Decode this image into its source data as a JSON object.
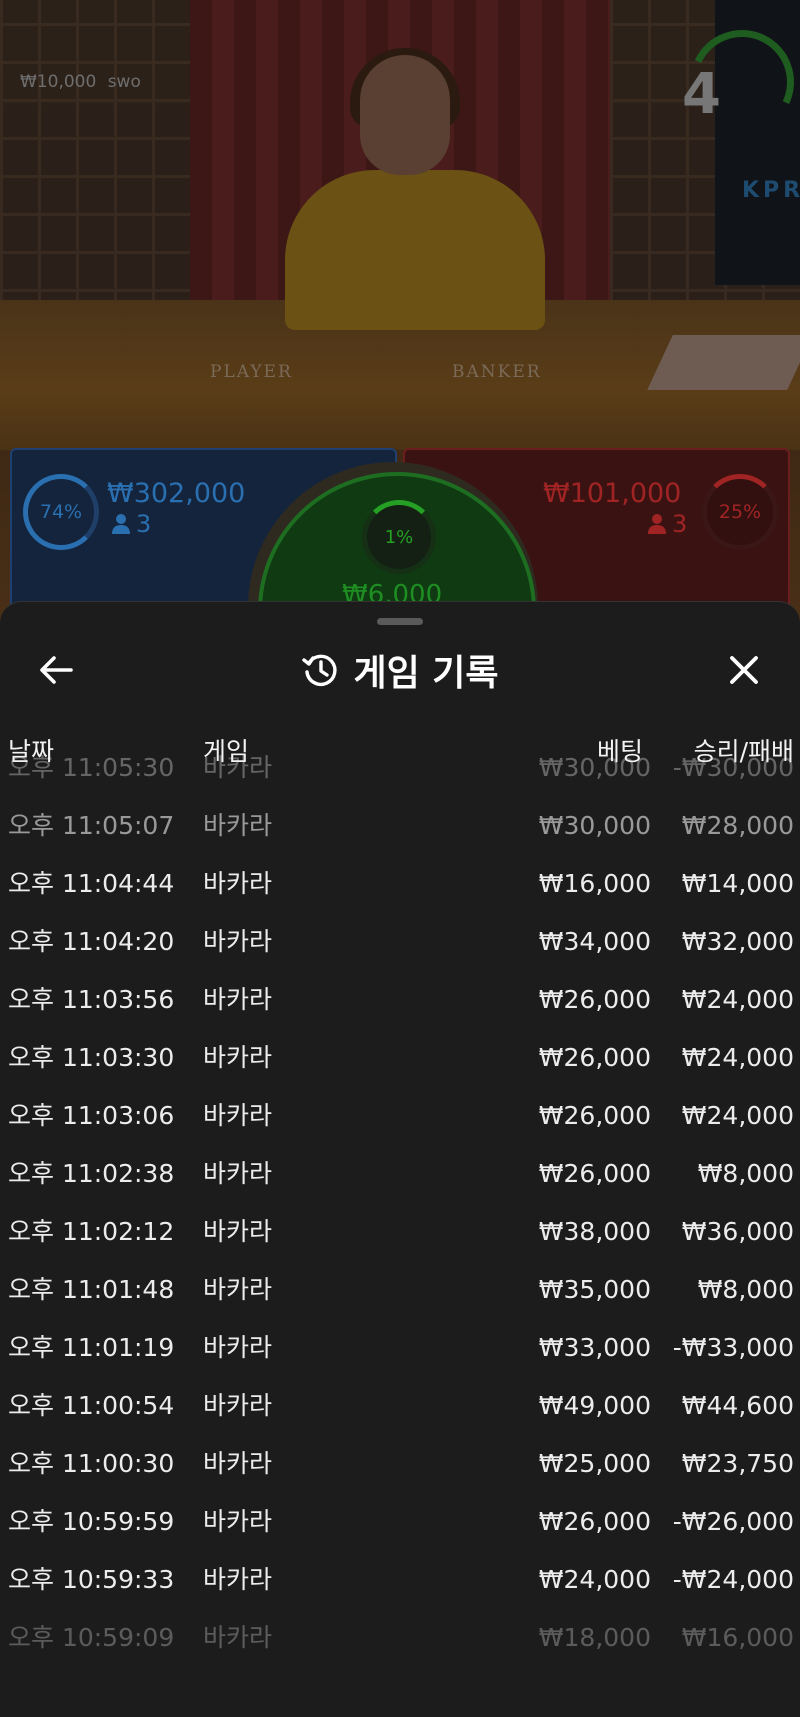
{
  "game": {
    "balance": "₩10,000",
    "username": "swo",
    "countdown": "4",
    "brand": "KPR",
    "table_labels": {
      "player": "PLAYER",
      "banker": "BANKER"
    },
    "player": {
      "percent": "74%",
      "amount": "₩302,000",
      "count": "3"
    },
    "banker": {
      "percent": "25%",
      "amount": "₩101,000",
      "count": "3"
    },
    "tie": {
      "percent": "1%",
      "amount": "₩6,000"
    },
    "colors": {
      "player": "#2a6fb0",
      "banker": "#a02424",
      "tie": "#1e8e22"
    }
  },
  "history": {
    "title": "게임 기록",
    "icons": {
      "back": "arrow-left-icon",
      "title": "history-icon",
      "close": "close-icon"
    },
    "columns": {
      "date": "날짜",
      "game": "게임",
      "bet": "베팅",
      "result": "승리/패배"
    },
    "rows": [
      {
        "time": "오후 11:05:30",
        "game": "바카라",
        "bet": "₩30,000",
        "result": "-₩30,000"
      },
      {
        "time": "오후 11:05:07",
        "game": "바카라",
        "bet": "₩30,000",
        "result": "₩28,000"
      },
      {
        "time": "오후 11:04:44",
        "game": "바카라",
        "bet": "₩16,000",
        "result": "₩14,000"
      },
      {
        "time": "오후 11:04:20",
        "game": "바카라",
        "bet": "₩34,000",
        "result": "₩32,000"
      },
      {
        "time": "오후 11:03:56",
        "game": "바카라",
        "bet": "₩26,000",
        "result": "₩24,000"
      },
      {
        "time": "오후 11:03:30",
        "game": "바카라",
        "bet": "₩26,000",
        "result": "₩24,000"
      },
      {
        "time": "오후 11:03:06",
        "game": "바카라",
        "bet": "₩26,000",
        "result": "₩24,000"
      },
      {
        "time": "오후 11:02:38",
        "game": "바카라",
        "bet": "₩26,000",
        "result": "₩8,000"
      },
      {
        "time": "오후 11:02:12",
        "game": "바카라",
        "bet": "₩38,000",
        "result": "₩36,000"
      },
      {
        "time": "오후 11:01:48",
        "game": "바카라",
        "bet": "₩35,000",
        "result": "₩8,000"
      },
      {
        "time": "오후 11:01:19",
        "game": "바카라",
        "bet": "₩33,000",
        "result": "-₩33,000"
      },
      {
        "time": "오후 11:00:54",
        "game": "바카라",
        "bet": "₩49,000",
        "result": "₩44,600"
      },
      {
        "time": "오후 11:00:30",
        "game": "바카라",
        "bet": "₩25,000",
        "result": "₩23,750"
      },
      {
        "time": "오후 10:59:59",
        "game": "바카라",
        "bet": "₩26,000",
        "result": "-₩26,000"
      },
      {
        "time": "오후 10:59:33",
        "game": "바카라",
        "bet": "₩24,000",
        "result": "-₩24,000"
      },
      {
        "time": "오후 10:59:09",
        "game": "바카라",
        "bet": "₩18,000",
        "result": "₩16,000"
      }
    ]
  }
}
